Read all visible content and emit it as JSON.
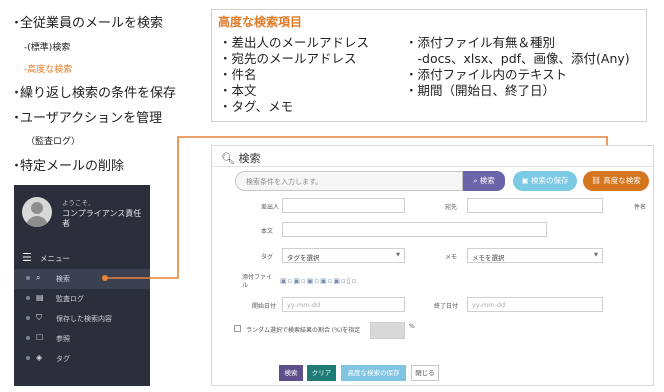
{
  "features": {
    "item1": "全従業員のメールを検索",
    "sub1": "-(標準)検索",
    "sub2": "-高度な検索",
    "item2": "繰り返し検索の条件を保存",
    "item3": "ユーザアクションを管理",
    "sub3": "（監査ログ）",
    "item4": "特定メールの削除",
    "bullet": "・"
  },
  "advanced_box": {
    "title": "高度な検索項目",
    "left_items": [
      "・差出人のメールアドレス",
      "・宛先のメールアドレス",
      "・件名",
      "・本文",
      "・タグ、メモ"
    ],
    "right_items": [
      "・添付ファイル有無＆種別",
      "　-docs、xlsx、pdf、画像、添付(Any)",
      "・添付ファイル内のテキスト",
      "・期間（開始日、終了日）"
    ]
  },
  "sidebar": {
    "welcome": "ようこそ、",
    "user_name": "コンプライアンス責任者",
    "menu_label": "メニュー",
    "items": [
      {
        "label": "検索",
        "icon": "⌕"
      },
      {
        "label": "監査ログ",
        "icon": "▤"
      },
      {
        "label": "保存した検索内容",
        "icon": "⛉"
      },
      {
        "label": "参照",
        "icon": "☐"
      },
      {
        "label": "タグ",
        "icon": "◈"
      }
    ]
  },
  "panel": {
    "title": "検索",
    "title_icon": "magnifier-icon",
    "search_placeholder": "検索条件を入力します。",
    "search_button": "検索",
    "save_button": "検索の保存",
    "advanced_button": "高度な検索",
    "labels": {
      "sender": "差出人",
      "to": "宛先",
      "subject": "件名",
      "body": "本文",
      "tag": "タグ",
      "memo": "メモ",
      "attachment": "添付ファイル",
      "start_date": "開始日付",
      "end_date": "終了日付",
      "random": "ランダム選択で検索結果の割合 (%)を指定",
      "percent": "%"
    },
    "tag_select": "タグを選択",
    "memo_select": "メモを選択",
    "date_placeholder": "yy-mm-dd",
    "attachment_icons": "▣▫▣▫▣▫▣▫▣▫▯▫",
    "bottom_buttons": {
      "search": "検索",
      "clear": "クリア",
      "save_advanced": "高度な検索の保存",
      "close": "閉じる"
    }
  },
  "colors": {
    "accent_orange": "#e07b2a",
    "sidebar_bg": "#2a2f3b",
    "search_button": "#6a64a8",
    "save_button": "#7cc9e3",
    "advanced_button": "#d6751f",
    "clear_button": "#1f7b76"
  }
}
